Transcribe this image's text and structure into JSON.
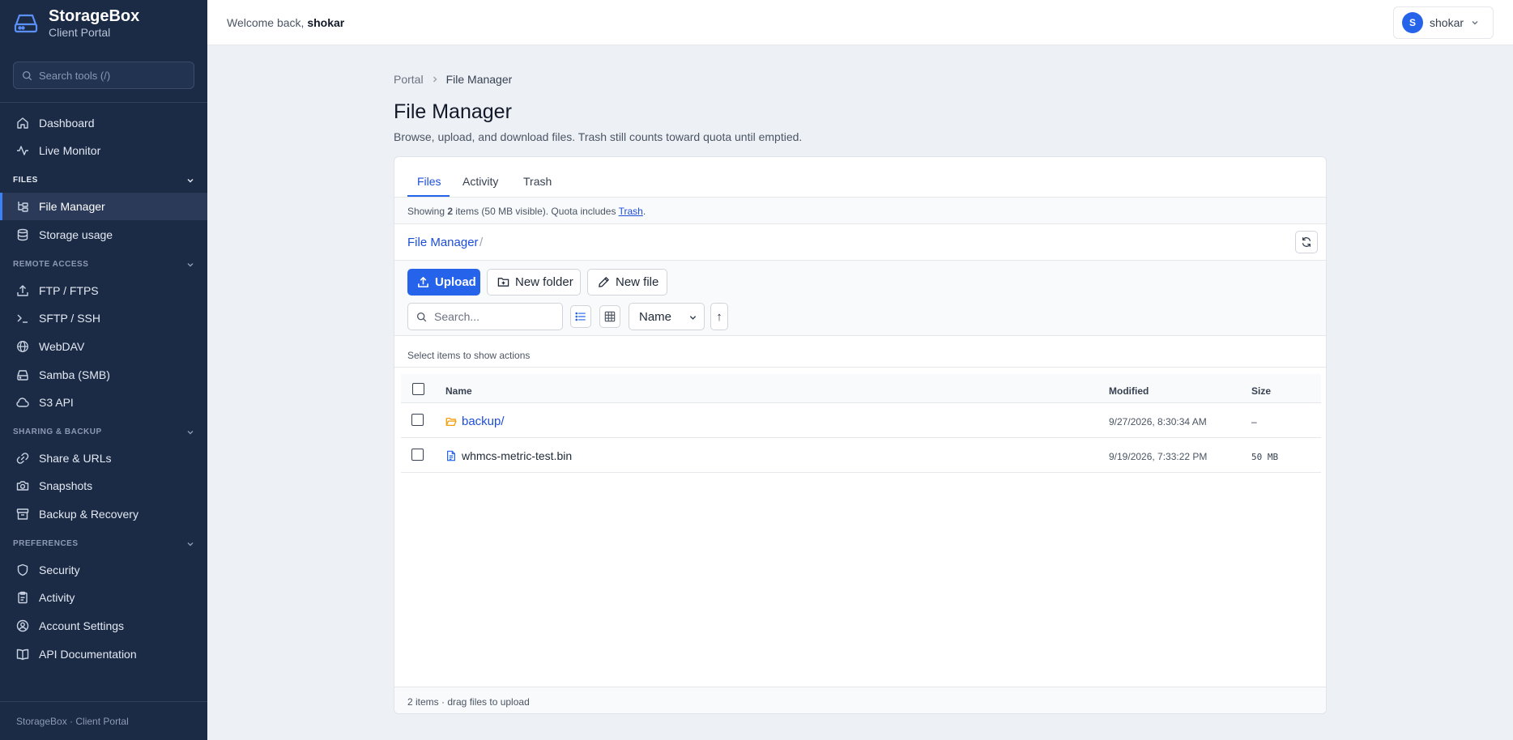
{
  "app": {
    "name": "StorageBox",
    "subtitle": "Client Portal",
    "footer": "StorageBox · Client Portal"
  },
  "sidebar": {
    "search_placeholder": "Search tools (/)",
    "top_items": [
      {
        "label": "Dashboard",
        "icon": "home-icon"
      },
      {
        "label": "Live Monitor",
        "icon": "activity-icon"
      }
    ],
    "sections": [
      {
        "title": "FILES",
        "items": [
          {
            "label": "File Manager",
            "icon": "folder-tree-icon",
            "active": true
          },
          {
            "label": "Storage usage",
            "icon": "database-icon"
          }
        ]
      },
      {
        "title": "REMOTE ACCESS",
        "items": [
          {
            "label": "FTP / FTPS",
            "icon": "upload-icon"
          },
          {
            "label": "SFTP / SSH",
            "icon": "terminal-icon"
          },
          {
            "label": "WebDAV",
            "icon": "globe-icon"
          },
          {
            "label": "Samba (SMB)",
            "icon": "hard-drive-icon"
          },
          {
            "label": "S3 API",
            "icon": "cloud-icon"
          }
        ]
      },
      {
        "title": "SHARING & BACKUP",
        "items": [
          {
            "label": "Share & URLs",
            "icon": "link-icon"
          },
          {
            "label": "Snapshots",
            "icon": "camera-icon"
          },
          {
            "label": "Backup & Recovery",
            "icon": "archive-icon"
          }
        ]
      },
      {
        "title": "PREFERENCES",
        "items": [
          {
            "label": "Security",
            "icon": "shield-icon"
          },
          {
            "label": "Activity",
            "icon": "clipboard-icon"
          },
          {
            "label": "Account Settings",
            "icon": "user-circle-icon"
          },
          {
            "label": "API Documentation",
            "icon": "book-icon"
          }
        ]
      }
    ]
  },
  "topbar": {
    "welcome_prefix": "Welcome back,",
    "username": "shokar",
    "avatar_initial": "S"
  },
  "breadcrumb": {
    "root": "Portal",
    "current": "File Manager"
  },
  "page": {
    "title": "File Manager",
    "description": "Browse, upload, and download files. Trash still counts toward quota until emptied."
  },
  "tabs": [
    {
      "label": "Files",
      "active": true
    },
    {
      "label": "Activity"
    },
    {
      "label": "Trash"
    }
  ],
  "info": {
    "showing_prefix": "Showing",
    "count": "2",
    "showing_suffix": "items (50 MB visible). Quota includes",
    "trash_link": "Trash",
    "period": "."
  },
  "path": {
    "root": "File Manager",
    "separator": "/"
  },
  "toolbar": {
    "upload": "Upload",
    "new_folder": "New folder",
    "new_file": "New file",
    "search_placeholder": "Search...",
    "sort_value": "Name",
    "sort_direction": "↑"
  },
  "actions_hint": "Select items to show actions",
  "table": {
    "headers": {
      "name": "Name",
      "modified": "Modified",
      "size": "Size"
    },
    "rows": [
      {
        "name": "backup/",
        "type": "folder",
        "modified": "9/27/2026, 8:30:34 AM",
        "size": "–"
      },
      {
        "name": "whmcs-metric-test.bin",
        "type": "file",
        "modified": "9/19/2026, 7:33:22 PM",
        "size": "50 MB"
      }
    ]
  },
  "footer_status": "2 items · drag files to upload",
  "colors": {
    "sidebar_bg": "#1c2b45",
    "accent": "#2563eb",
    "folder": "#f59e0b",
    "page_bg": "#edf1f6"
  }
}
